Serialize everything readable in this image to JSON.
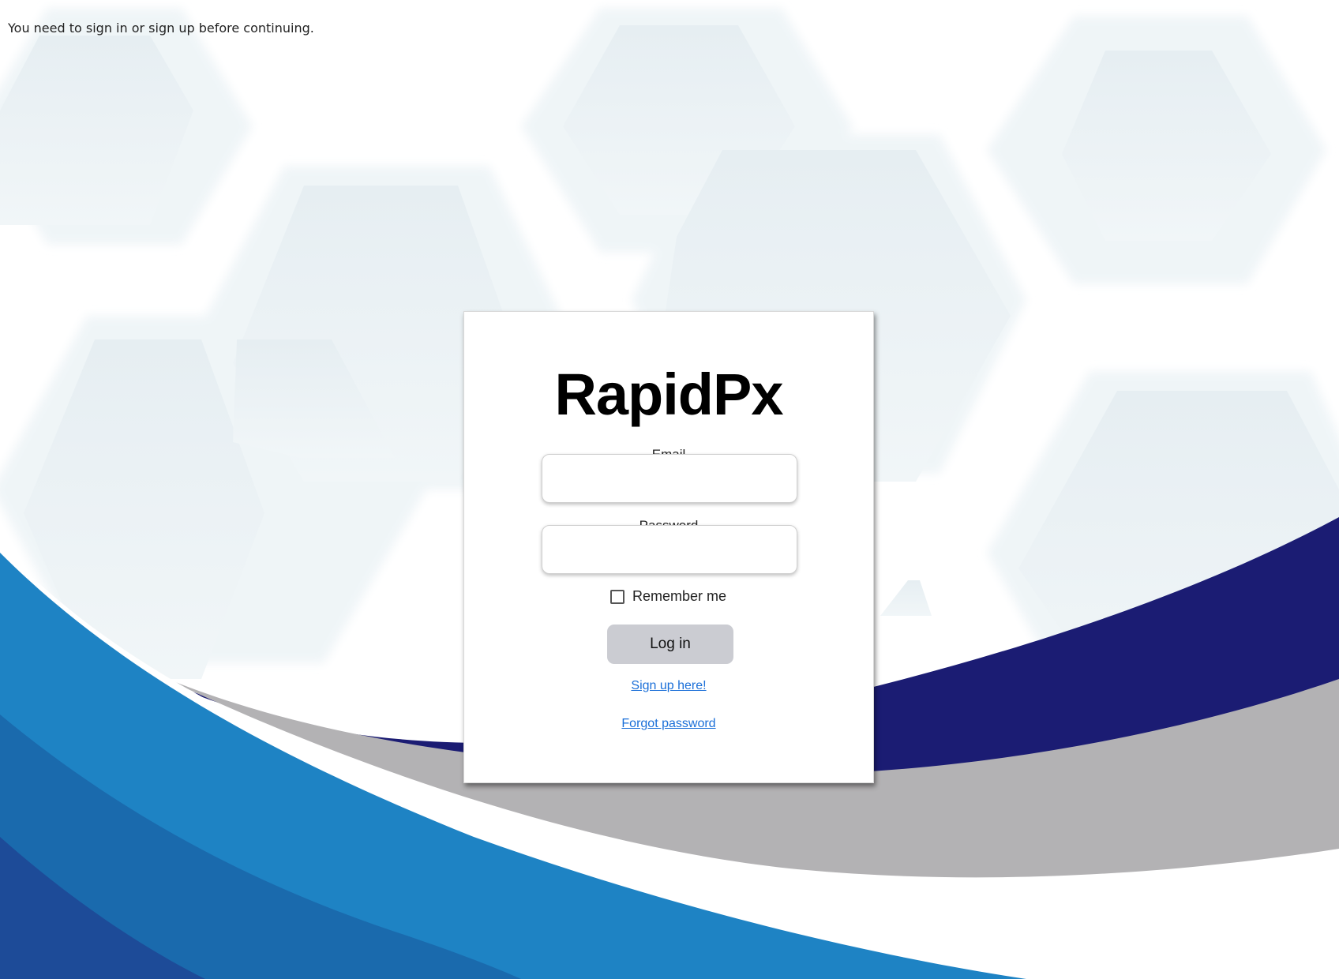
{
  "flash": {
    "message": "You need to sign in or sign up before continuing."
  },
  "login": {
    "title": "RapidPx",
    "email_label": "Email",
    "email_value": "",
    "password_label": "Password",
    "password_value": "",
    "remember_label": "Remember me",
    "remember_checked": false,
    "login_button": "Log in",
    "signup_link": "Sign up here!",
    "forgot_link": "Forgot password"
  },
  "colors": {
    "navy_wave": "#1b1c73",
    "blue_wave": "#1e83c4",
    "gray_wave": "#b3b2b4",
    "button_bg": "#cbccd2",
    "link": "#1a6fd8"
  }
}
